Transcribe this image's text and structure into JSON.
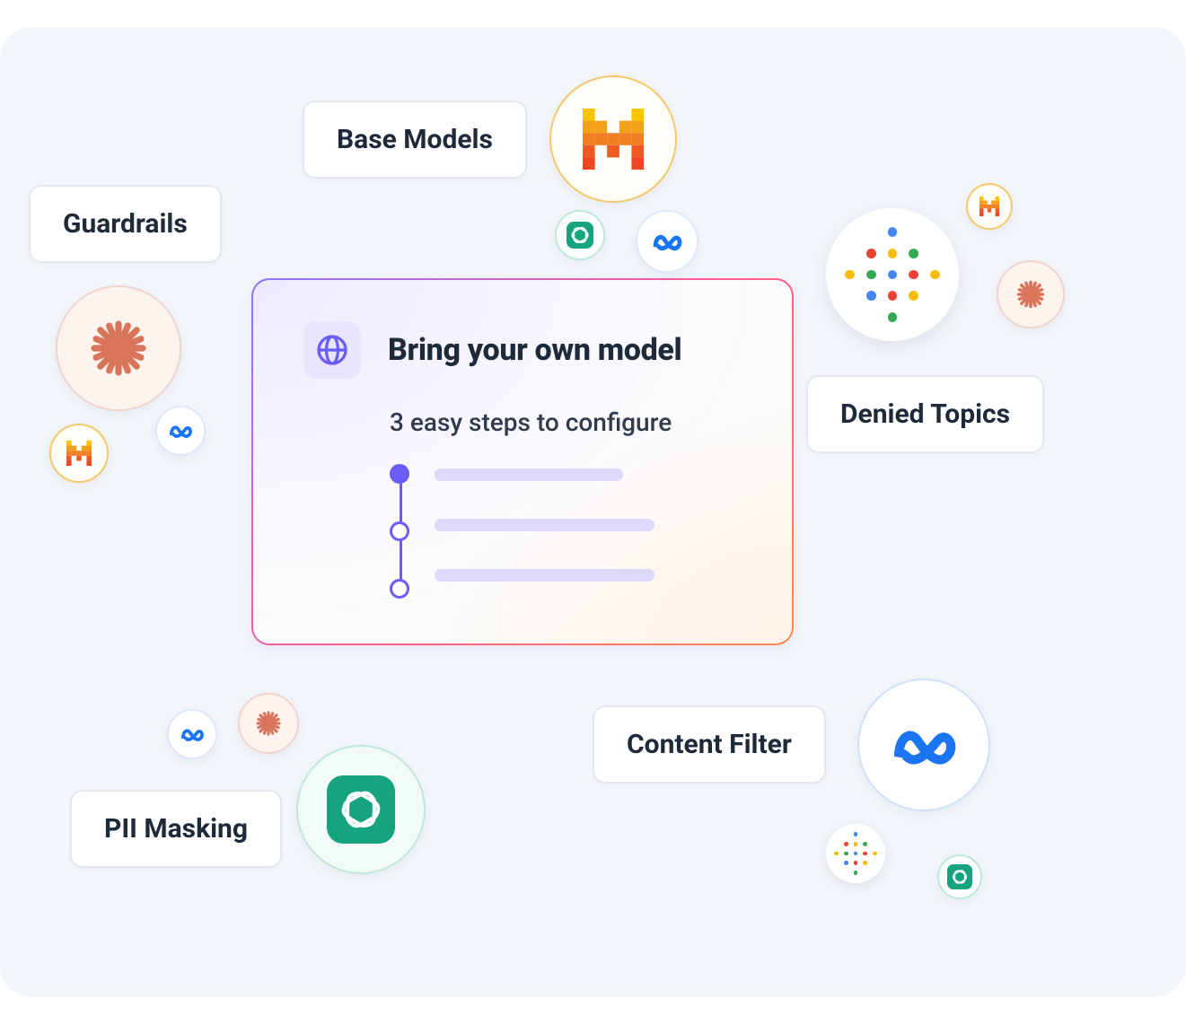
{
  "card": {
    "title": "Bring your own model",
    "subtitle": "3 easy steps to configure",
    "steps_count": 3
  },
  "chips": {
    "base_models": "Base Models",
    "guardrails": "Guardrails",
    "denied_topics": "Denied Topics",
    "content_filter": "Content Filter",
    "pii_masking": "PII Masking"
  },
  "brands": {
    "mistral": "Mistral",
    "openai": "OpenAI",
    "meta": "Meta",
    "google": "Google",
    "claude": "Claude"
  },
  "colors": {
    "indigo": "#6a5cf6",
    "openai_green": "#16a37f",
    "meta_blue": "#1975f1",
    "claude_terra": "#d9755a",
    "mistral_orange": "#f4a11a",
    "mistral_red": "#ef4723",
    "google_blue": "#4285F4",
    "google_red": "#EA4335",
    "google_yellow": "#FBBC05",
    "google_green": "#34A853"
  }
}
